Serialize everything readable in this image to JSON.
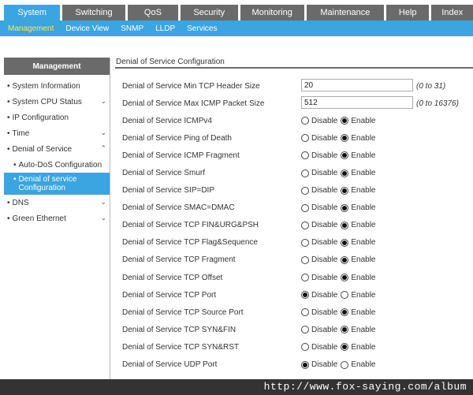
{
  "topnav": [
    {
      "label": "System",
      "active": true
    },
    {
      "label": "Switching"
    },
    {
      "label": "QoS"
    },
    {
      "label": "Security"
    },
    {
      "label": "Monitoring"
    },
    {
      "label": "Maintenance"
    },
    {
      "label": "Help"
    },
    {
      "label": "Index"
    }
  ],
  "subnav": [
    {
      "label": "Management",
      "active": true
    },
    {
      "label": "Device View"
    },
    {
      "label": "SNMP"
    },
    {
      "label": "LLDP"
    },
    {
      "label": "Services"
    }
  ],
  "sidebar": {
    "header": "Management",
    "items": [
      {
        "label": "System Information",
        "prefix": "•"
      },
      {
        "label": "System CPU Status",
        "prefix": "•",
        "chevron": "⌄"
      },
      {
        "label": "IP Configuration",
        "prefix": "•"
      },
      {
        "label": "Time",
        "prefix": "•",
        "chevron": "⌄"
      },
      {
        "label": "Denial of Service",
        "prefix": "•",
        "chevron": "⌃"
      },
      {
        "label": "Auto-DoS Configuration",
        "prefix": "•"
      },
      {
        "label": "Denial of service Configuration",
        "prefix": "•"
      },
      {
        "label": "DNS",
        "prefix": "•",
        "chevron": "⌄"
      },
      {
        "label": "Green Ethernet",
        "prefix": "•",
        "chevron": "⌄"
      }
    ]
  },
  "main": {
    "title": "Denial of Service Configuration",
    "text_rows": [
      {
        "label": "Denial of Service Min TCP Header Size",
        "value": "20",
        "hint": "(0 to 31)"
      },
      {
        "label": "Denial of Service Max ICMP Packet Size",
        "value": "512",
        "hint": "(0 to 16376)"
      }
    ],
    "disable_label": "Disable",
    "enable_label": "Enable",
    "radio_rows": [
      {
        "label": "Denial of Service ICMPv4",
        "selected": "Enable"
      },
      {
        "label": "Denial of Service Ping of Death",
        "selected": "Enable"
      },
      {
        "label": "Denial of Service ICMP Fragment",
        "selected": "Enable"
      },
      {
        "label": "Denial of Service Smurf",
        "selected": "Enable"
      },
      {
        "label": "Denial of Service SIP=DIP",
        "selected": "Enable"
      },
      {
        "label": "Denial of Service SMAC=DMAC",
        "selected": "Enable"
      },
      {
        "label": "Denial of Service TCP FIN&URG&PSH",
        "selected": "Enable"
      },
      {
        "label": "Denial of Service TCP Flag&Sequence",
        "selected": "Enable"
      },
      {
        "label": "Denial of Service TCP Fragment",
        "selected": "Enable"
      },
      {
        "label": "Denial of Service TCP Offset",
        "selected": "Enable"
      },
      {
        "label": "Denial of Service TCP Port",
        "selected": "Disable"
      },
      {
        "label": "Denial of Service TCP Source Port",
        "selected": "Enable"
      },
      {
        "label": "Denial of Service TCP SYN&FIN",
        "selected": "Enable"
      },
      {
        "label": "Denial of Service TCP SYN&RST",
        "selected": "Enable"
      },
      {
        "label": "Denial of Service UDP Port",
        "selected": "Disable"
      }
    ]
  },
  "footer": {
    "url": "http://www.fox-saying.com/album"
  }
}
